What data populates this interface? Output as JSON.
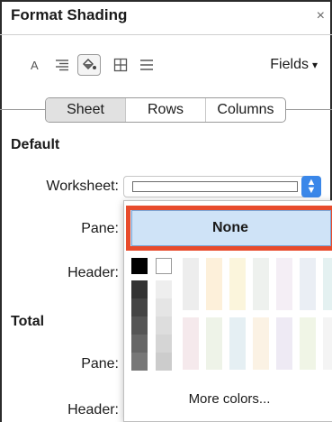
{
  "panel": {
    "title": "Format Shading",
    "close_symbol": "×"
  },
  "toolbar": {
    "icons": [
      "font-icon",
      "align-icon",
      "shading-icon",
      "borders-icon",
      "lines-icon"
    ],
    "selected_icon": "shading-icon",
    "fields_label": "Fields",
    "fields_caret": "▾"
  },
  "tabs": [
    "Sheet",
    "Rows",
    "Columns"
  ],
  "selected_tab": "Sheet",
  "default_section": {
    "heading": "Default",
    "worksheet_label": "Worksheet:",
    "pane_label": "Pane:",
    "header_label": "Header:"
  },
  "total_section": {
    "heading": "Total",
    "pane_label": "Pane:",
    "header_label": "Header:"
  },
  "color_popup": {
    "none_label": "None",
    "more_colors_label": "More colors...",
    "highlight_color": "#e84b2c",
    "accent_color": "#3a87e9",
    "top_swatches": [
      "#000000",
      "#ffffff"
    ],
    "grays": [
      "#333333",
      "#444444",
      "#555555",
      "#666666",
      "#777777",
      "#cccccc",
      "#d5d5d5",
      "#dddddd",
      "#e5e5e5",
      "#eeeeee"
    ],
    "pastel_columns": [
      "#eeeeee",
      "#fdf1dc",
      "#fbf6dc",
      "#eef1ee",
      "#f4eef5",
      "#eaeef4",
      "#e4f1f1",
      "#edf5e6"
    ]
  }
}
